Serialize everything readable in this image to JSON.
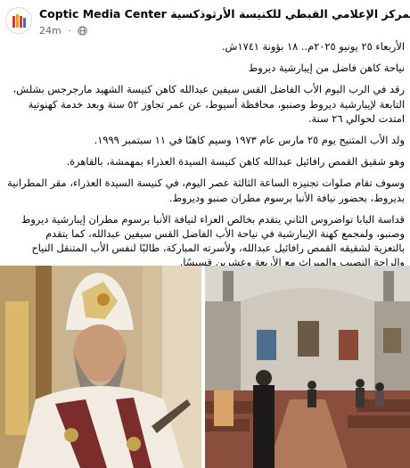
{
  "post": {
    "page_name": "Coptic Media Center المركز الإعلامي القبطي للكنيسة الأرثوذكسية",
    "time": "24m",
    "dot": "·",
    "paragraphs": [
      [
        "الأربعاء ٢٥ يونيو ٢٠٢٥م.. ١٨ بؤونة ١٧٤١ش."
      ],
      [
        "نياحة كاهن فاضل من إيبارشية ديروط"
      ],
      [
        "رقد في الرب اليوم الأب الفاضل القس سيفين عبدالله كاهن كنيسة الشهيد مارجرجس بشلش،",
        "التابعة لإيبارشية ديروط وصنبو، محافظة أسيوط، عن عمر تجاوز ٥٢ سنة وبعد خدمة كهنوتية",
        "امتدت لحوالي ٢٦ سنة."
      ],
      [
        "ولد الأب المتنيح يوم ٢٥ مارس عام ١٩٧٣ وسيم كاهنًا في ١١ سبتمبر ١٩٩٩."
      ],
      [
        "وهو شقيق القمص رافائيل عبدالله كاهن كنيسة السيدة العذراء بمهمشة، بالقاهرة."
      ],
      [
        "وسوف تقام صلوات تجنيزه الساعة الثالثة عصر اليوم، في كنيسة السيدة العذراء، مقر المطرانية",
        "بديروط، بحضور نيافة الأنبا برسوم مطران صنبو وديروط."
      ],
      [
        "قداسة البابا تواضروس الثاني يتقدم بخالص العزاء لنيافة الأنبا برسوم مطران إيبارشية ديروط",
        "وصنبو، ولمجمع كهنة الإيبارشية في نياحة الأب الفاضل القس سيفين عبدالله، كما يتقدم",
        "بالتعزية لشقيقه القمص رافائيل عبدالله، ولأسرته المباركة، طالبًا لنفس الأب المتنقل النياح",
        "والراحة النصيب والميراث مع الأربعة وعشرين قسيسًا."
      ]
    ]
  },
  "icons": {
    "avatar": "coptic-media-logo",
    "privacy": "globe-icon"
  },
  "colors": {
    "meta_text": "#65676b",
    "logo_red": "#d93a2b"
  }
}
